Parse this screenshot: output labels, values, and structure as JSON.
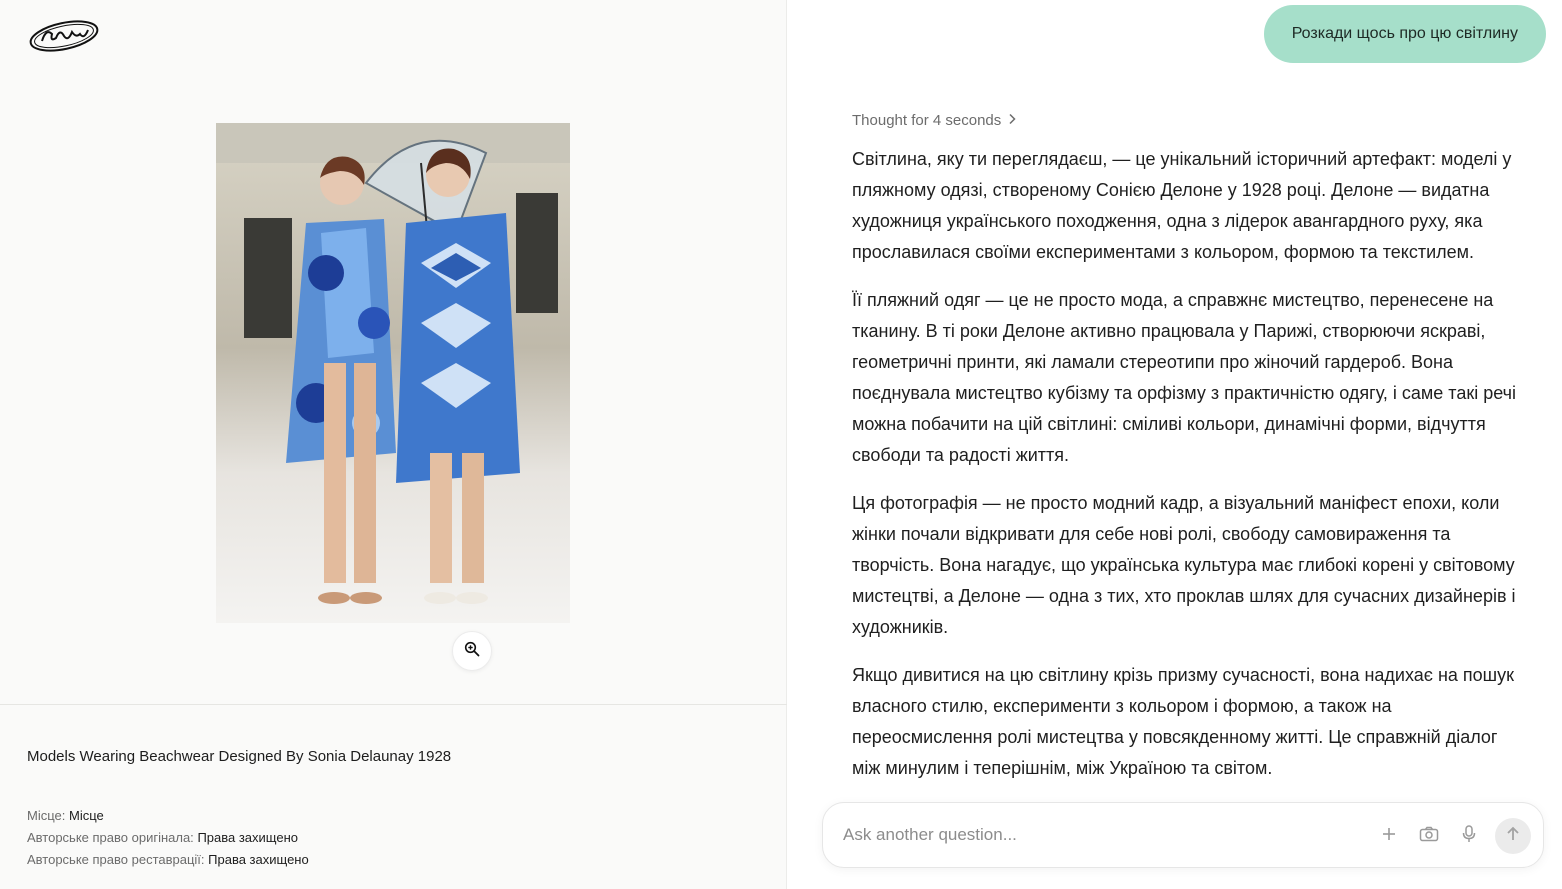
{
  "image_panel": {
    "caption": "Models Wearing Beachwear Designed By Sonia Delaunay 1928",
    "meta": [
      {
        "label": "Місце:",
        "value": "Місце"
      },
      {
        "label": "Авторське право оригінала:",
        "value": "Права захищено"
      },
      {
        "label": "Авторське право реставрації:",
        "value": "Права захищено"
      }
    ]
  },
  "chat": {
    "user_message": "Розкади щось про цю світлину",
    "thought_label": "Thought for 4 seconds",
    "paragraphs": [
      "Світлина, яку ти переглядаєш, — це унікальний історичний артефакт: моделі у пляжному одязі, створеному Сонією Делоне у 1928 році. Делоне — видатна художниця українського походження, одна з лідерок авангардного руху, яка прославилася своїми експериментами з кольором, формою та текстилем.",
      "Її пляжний одяг — це не просто мода, а справжнє мистецтво, перенесене на тканину. В ті роки Делоне активно працювала у Парижі, створюючи яскраві, геометричні принти, які ламали стереотипи про жіночий гардероб. Вона поєднувала мистецтво кубізму та орфізму з практичністю одягу, і саме такі речі можна побачити на цій світлині: сміливі кольори, динамічні форми, відчуття свободи та радості життя.",
      "Ця фотографія — не просто модний кадр, а візуальний маніфест епохи, коли жінки почали відкривати для себе нові ролі, свободу самовираження та творчість. Вона нагадує, що українська культура має глибокі корені у світовому мистецтві, а Делоне — одна з тих, хто проклав шлях для сучасних дизайнерів і художників.",
      "Якщо дивитися на цю світлину крізь призму сучасності, вона надихає на пошук власного стилю, експерименти з кольором і формою, а також на переосмислення ролі мистецтва у повсякденному житті. Це справжній діалог між минулим і теперішнім, між Україною та світом."
    ],
    "composer_placeholder": "Ask another question..."
  },
  "icons": {
    "logo": "brand-logo",
    "zoom": "zoom-in-icon",
    "chevron": "chevron-right-icon",
    "plus": "plus-icon",
    "camera": "camera-icon",
    "mic": "microphone-icon",
    "send": "arrow-up-icon"
  },
  "colors": {
    "user_bubble": "#a6dfca",
    "left_panel_bg": "#fafaf9"
  }
}
